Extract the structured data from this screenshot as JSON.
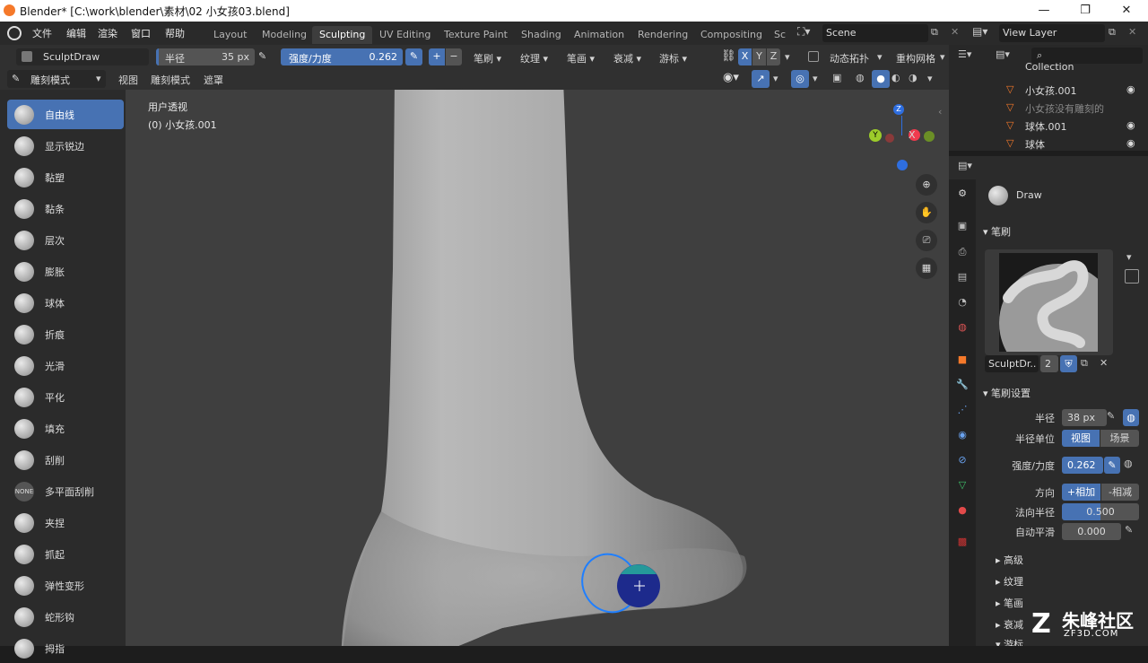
{
  "titlebar": {
    "title": "Blender* [C:\\work\\blender\\素材\\02 小女孩03.blend]",
    "minimize": "—",
    "maximize": "❐",
    "close": "✕"
  },
  "menu": {
    "items": [
      "文件",
      "编辑",
      "渲染",
      "窗口",
      "帮助"
    ]
  },
  "workspaces": {
    "tabs": [
      "Layout",
      "Modeling",
      "Sculpting",
      "UV Editing",
      "Texture Paint",
      "Shading",
      "Animation",
      "Rendering",
      "Compositing",
      "Sc"
    ],
    "active": "Sculpting"
  },
  "scene": {
    "label": "Scene",
    "viewlayer": "View Layer"
  },
  "toolheader": {
    "brush_name": "SculptDraw",
    "radius_label": "半径",
    "radius_value": "35 px",
    "strength_label": "强度/力度",
    "strength_value": "0.262",
    "plus": "+",
    "minus": "−",
    "menus": [
      "笔刷",
      "纹理",
      "笔画",
      "衰减",
      "游标"
    ],
    "axes": [
      "X",
      "Y",
      "Z"
    ],
    "dyntopo": "动态拓扑",
    "remesh": "重构网格"
  },
  "modebar": {
    "mode": "雕刻模式",
    "items": [
      "视图",
      "雕刻模式",
      "遮罩"
    ]
  },
  "tools": [
    {
      "label": "自由线",
      "active": true
    },
    {
      "label": "显示锐边"
    },
    {
      "label": "黏塑"
    },
    {
      "label": "黏条"
    },
    {
      "label": "层次"
    },
    {
      "label": "膨胀"
    },
    {
      "label": "球体"
    },
    {
      "label": "折痕"
    },
    {
      "label": "光滑"
    },
    {
      "label": "平化"
    },
    {
      "label": "填充"
    },
    {
      "label": "刮削"
    },
    {
      "label": "多平面刮削",
      "icon_text": "NONE"
    },
    {
      "label": "夹捏"
    },
    {
      "label": "抓起"
    },
    {
      "label": "弹性变形"
    },
    {
      "label": "蛇形钩"
    },
    {
      "label": "拇指"
    }
  ],
  "viewport": {
    "view_name": "用户透视",
    "object_name": "(0) 小女孩.001",
    "gizmo_x": "X",
    "gizmo_y": "Y",
    "gizmo_z": "Z"
  },
  "outliner": {
    "items": [
      {
        "label": "Collection"
      },
      {
        "label": "小女孩.001"
      },
      {
        "label": "小女孩没有雕刻的"
      },
      {
        "label": "球体.001"
      },
      {
        "label": "球体"
      }
    ]
  },
  "props": {
    "brush_title": "Draw",
    "panel_brush": "笔刷",
    "brush_datablock": "SculptDr..",
    "brush_users": "2",
    "panel_settings": "笔刷设置",
    "radius_label": "半径",
    "radius_value": "38 px",
    "radius_unit_label": "半径单位",
    "unit_view": "视图",
    "unit_scene": "场景",
    "strength_label": "强度/力度",
    "strength_value": "0.262",
    "direction_label": "方向",
    "dir_add": "+相加",
    "dir_sub": "-相减",
    "normal_radius_label": "法向半径",
    "normal_radius_value": "0.500",
    "normal_radius_fraction": 0.5,
    "autosmooth_label": "自动平滑",
    "autosmooth_value": "0.000",
    "subpanels": [
      "高级",
      "纹理",
      "笔画",
      "衰减",
      "游标"
    ]
  },
  "watermark": {
    "text": "朱峰社区",
    "sub": "ZF3D.COM"
  },
  "colors": {
    "accent": "#4772b3",
    "orange": "#f5792a",
    "bg_dark": "#282828",
    "viewport": "#3f3f3f"
  }
}
